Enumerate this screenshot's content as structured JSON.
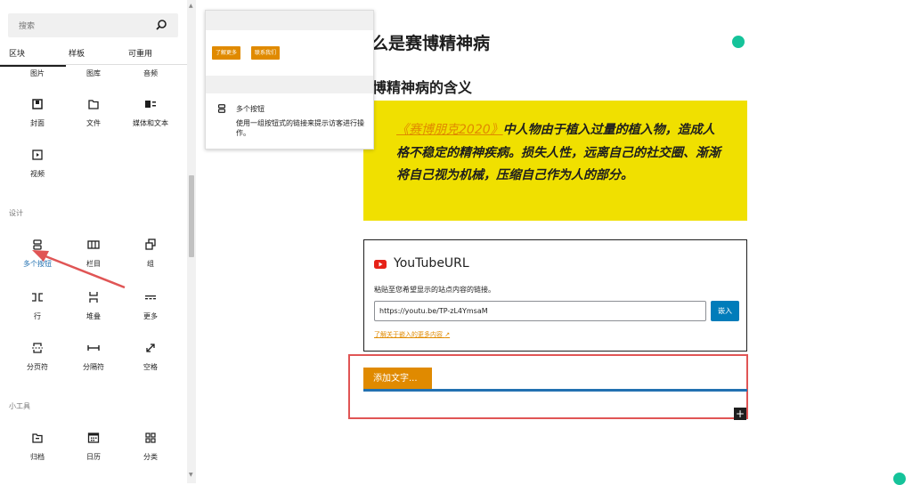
{
  "sidebar": {
    "search_placeholder": "搜索",
    "tabs": [
      "区块",
      "样板",
      "可重用"
    ],
    "partial_row": [
      "图片",
      "图库",
      "音频"
    ],
    "media_blocks": [
      {
        "label": "封面",
        "icon": "cover-icon"
      },
      {
        "label": "文件",
        "icon": "file-icon"
      },
      {
        "label": "媒体和文本",
        "icon": "media-text-icon"
      },
      {
        "label": "视频",
        "icon": "video-icon"
      }
    ],
    "design_category": "设计",
    "design_blocks": [
      {
        "label": "多个按钮",
        "icon": "buttons-icon"
      },
      {
        "label": "栏目",
        "icon": "columns-icon"
      },
      {
        "label": "组",
        "icon": "group-icon"
      },
      {
        "label": "行",
        "icon": "row-icon"
      },
      {
        "label": "堆叠",
        "icon": "stack-icon"
      },
      {
        "label": "更多",
        "icon": "more-icon"
      },
      {
        "label": "分页符",
        "icon": "page-break-icon"
      },
      {
        "label": "分隔符",
        "icon": "separator-icon"
      },
      {
        "label": "空格",
        "icon": "spacer-icon"
      }
    ],
    "widgets_category": "小工具",
    "widget_blocks": [
      {
        "label": "归档",
        "icon": "archive-icon"
      },
      {
        "label": "日历",
        "icon": "calendar-icon"
      },
      {
        "label": "分类",
        "icon": "categories-icon"
      }
    ]
  },
  "preview": {
    "button1": "了解更多",
    "button2": "联系我们",
    "title": "多个按钮",
    "description": "使用一组按钮式的链接来提示访客进行操作。"
  },
  "editor": {
    "heading": "什么是赛博精神病",
    "subheading": "赛博精神病的含义",
    "quote_link": "《赛博朋克2020》",
    "quote_text": "中人物由于植入过量的植入物，造成人格不稳定的精神疾病。损失人性，远离自己的社交圈、渐渐将自己视为机械，压缩自己作为人的部分。",
    "quote_bg": "#f0e000",
    "embed": {
      "title": "YouTubeURL",
      "instruction": "粘贴至您希望显示的站点内容的链接。",
      "url_value": "https://youtu.be/TP-zL4YmsaM",
      "embed_button": "嵌入",
      "learn_more": "了解关于嵌入的更多内容"
    },
    "add_text_button": "添加文字...",
    "accent": "#e08a00",
    "highlight": "#2271b1"
  }
}
